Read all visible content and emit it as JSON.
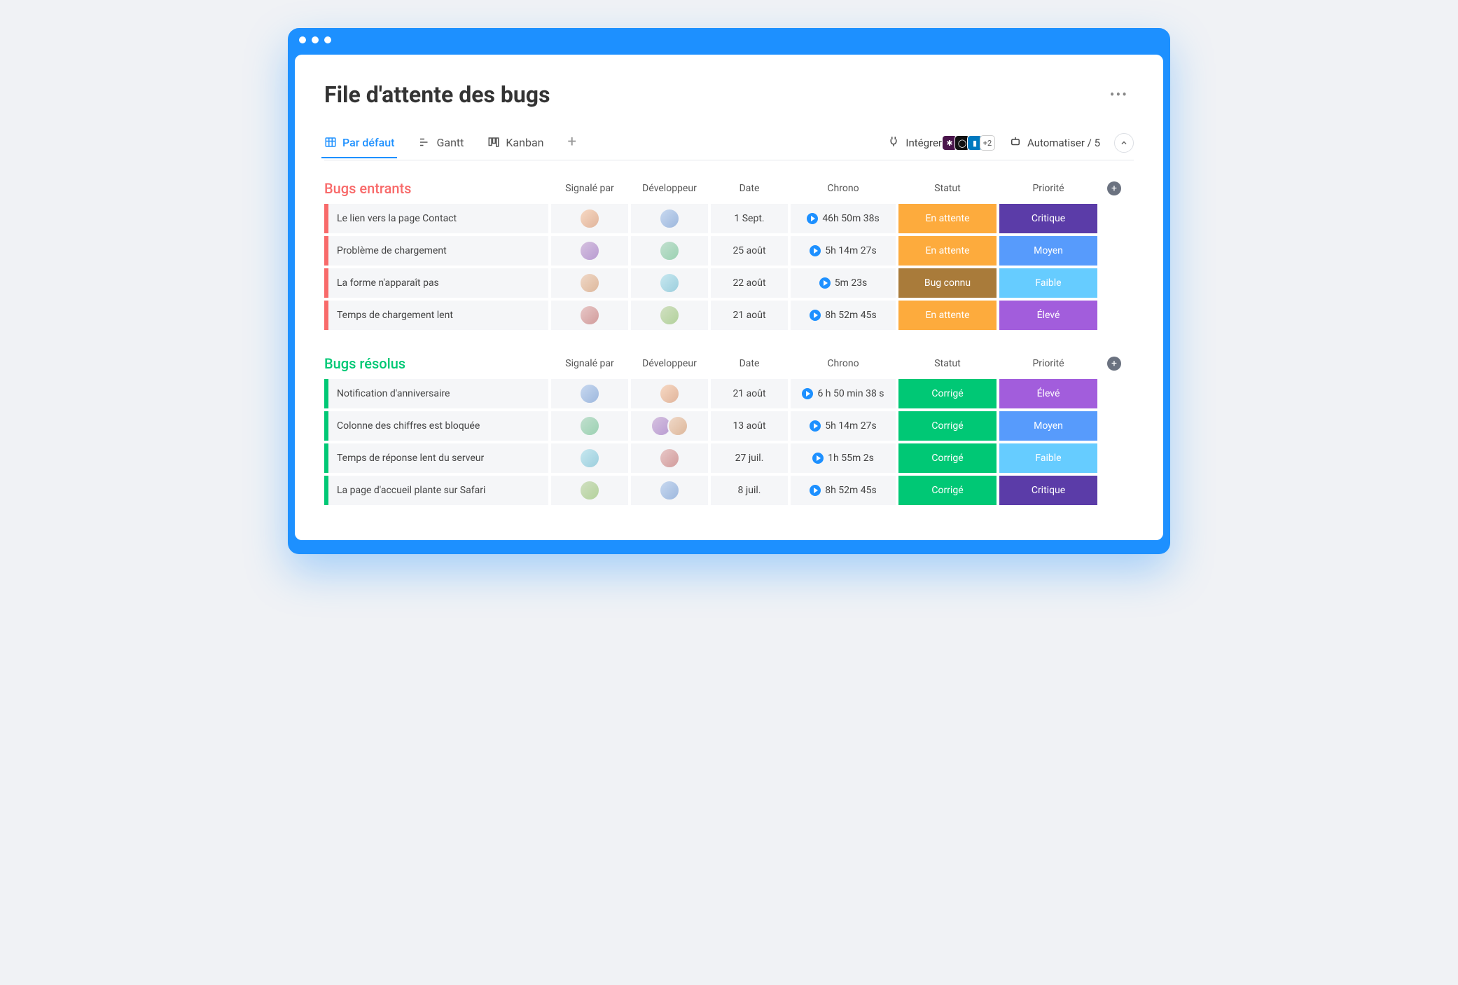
{
  "title": "File d'attente des bugs",
  "views": {
    "default": "Par défaut",
    "gantt": "Gantt",
    "kanban": "Kanban"
  },
  "toolbar": {
    "integrate": "Intégrer",
    "automate": "Automatiser / 5",
    "extra_integrations": "+2"
  },
  "columns": {
    "reporter": "Signalé par",
    "developer": "Développeur",
    "date": "Date",
    "timer": "Chrono",
    "status": "Statut",
    "priority": "Priorité"
  },
  "status_colors": {
    "En attente": "#fdab3d",
    "Bug connu": "#a97b3a",
    "Corrigé": "#00c875"
  },
  "priority_colors": {
    "Critique": "#5b3ca8",
    "Élevé": "#a25ddc",
    "Moyen": "#579bfc",
    "Faible": "#66ccff"
  },
  "groups": [
    {
      "title": "Bugs entrants",
      "color": "red",
      "rows": [
        {
          "name": "Le lien vers la page Contact",
          "reporter": [
            "a1"
          ],
          "developer": [
            "a2"
          ],
          "date": "1 Sept.",
          "timer": "46h 50m 38s",
          "status": "En attente",
          "priority": "Critique"
        },
        {
          "name": "Problème de chargement",
          "reporter": [
            "a3"
          ],
          "developer": [
            "a4"
          ],
          "date": "25 août",
          "timer": "5h 14m 27s",
          "status": "En attente",
          "priority": "Moyen"
        },
        {
          "name": "La forme n'apparaît pas",
          "reporter": [
            "a5"
          ],
          "developer": [
            "a6"
          ],
          "date": "22 août",
          "timer": "5m 23s",
          "status": "Bug connu",
          "priority": "Faible"
        },
        {
          "name": "Temps de chargement lent",
          "reporter": [
            "a7"
          ],
          "developer": [
            "a8"
          ],
          "date": "21 août",
          "timer": "8h 52m 45s",
          "status": "En attente",
          "priority": "Élevé"
        }
      ]
    },
    {
      "title": "Bugs résolus",
      "color": "green",
      "rows": [
        {
          "name": "Notification d'anniversaire",
          "reporter": [
            "a2"
          ],
          "developer": [
            "a1"
          ],
          "date": "21 août",
          "timer": "6 h 50 min 38 s",
          "status": "Corrigé",
          "priority": "Élevé"
        },
        {
          "name": "Colonne des chiffres est bloquée",
          "reporter": [
            "a4"
          ],
          "developer": [
            "a3",
            "a5"
          ],
          "date": "13 août",
          "timer": "5h 14m 27s",
          "status": "Corrigé",
          "priority": "Moyen"
        },
        {
          "name": "Temps de réponse lent du serveur",
          "reporter": [
            "a6"
          ],
          "developer": [
            "a7"
          ],
          "date": "27 juil.",
          "timer": "1h 55m 2s",
          "status": "Corrigé",
          "priority": "Faible"
        },
        {
          "name": "La page d'accueil plante sur Safari",
          "reporter": [
            "a8"
          ],
          "developer": [
            "a2"
          ],
          "date": "8 juil.",
          "timer": "8h 52m 45s",
          "status": "Corrigé",
          "priority": "Critique"
        }
      ]
    }
  ]
}
